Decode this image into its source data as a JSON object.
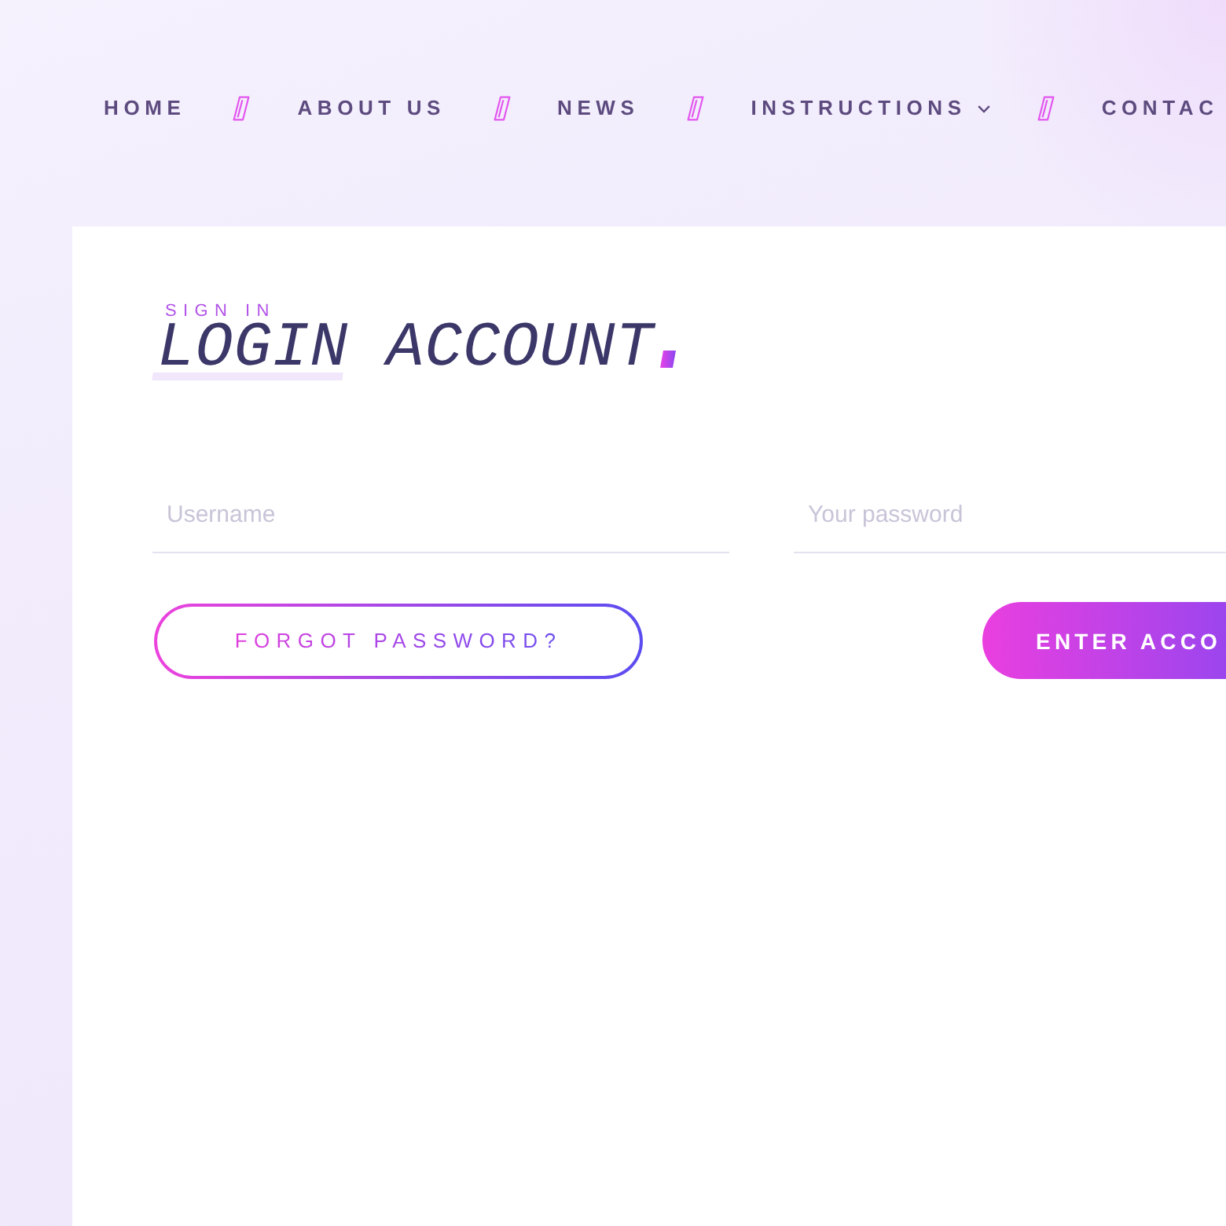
{
  "nav": {
    "items": [
      {
        "label": "HOME",
        "dropdown": false
      },
      {
        "label": "ABOUT US",
        "dropdown": false
      },
      {
        "label": "NEWS",
        "dropdown": false
      },
      {
        "label": "INSTRUCTIONS",
        "dropdown": true
      },
      {
        "label": "CONTAC",
        "dropdown": false
      }
    ]
  },
  "login": {
    "eyebrow": "SIGN IN",
    "title": "LOGIN ACCOUNT",
    "fields": [
      {
        "placeholder": "Username"
      },
      {
        "placeholder": "Your password"
      }
    ],
    "buttons": [
      {
        "kind": "outline",
        "label": "FORGOT PASSWORD?"
      },
      {
        "kind": "filled",
        "label": "ENTER ACCO"
      }
    ]
  }
}
